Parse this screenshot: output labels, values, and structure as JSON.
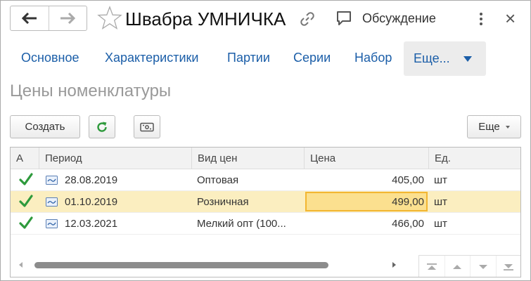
{
  "window": {
    "title": "Швабра УМНИЧКА",
    "discussion_label": "Обсуждение",
    "close_glyph": "×"
  },
  "tabs": [
    {
      "label": "Основное"
    },
    {
      "label": "Характеристики"
    },
    {
      "label": "Партии"
    },
    {
      "label": "Серии"
    },
    {
      "label": "Набор"
    }
  ],
  "more_tab": {
    "label": "Еще..."
  },
  "section": {
    "title": "Цены номенклатуры"
  },
  "toolbar": {
    "create_label": "Создать",
    "more_label": "Еще"
  },
  "table": {
    "columns": [
      "А",
      "Период",
      "Вид цен",
      "Цена",
      "Ед."
    ],
    "rows": [
      {
        "period": "28.08.2019",
        "price_type": "Оптовая",
        "price": "405,00",
        "unit": "шт",
        "active": true,
        "selected": false
      },
      {
        "period": "01.10.2019",
        "price_type": "Розничная",
        "price": "499,00",
        "unit": "шт",
        "active": true,
        "selected": true
      },
      {
        "period": "12.03.2021",
        "price_type": "Мелкий опт (100...",
        "price": "466,00",
        "unit": "шт",
        "active": true,
        "selected": false
      }
    ]
  },
  "colors": {
    "link": "#1b5ea8",
    "check": "#2e9a3c",
    "selected_row": "#fbeec0",
    "current_cell": "#fbe08f",
    "current_cell_border": "#f2b632"
  },
  "icons": [
    "back-arrow-icon",
    "forward-arrow-icon",
    "favorite-star-icon",
    "link-icon",
    "discussion-icon",
    "more-vertical-icon",
    "close-icon",
    "refresh-icon",
    "bank-note-icon",
    "check-icon",
    "document-icon",
    "scroll-to-first-icon",
    "scroll-up-icon",
    "scroll-down-icon",
    "scroll-to-last-icon"
  ]
}
